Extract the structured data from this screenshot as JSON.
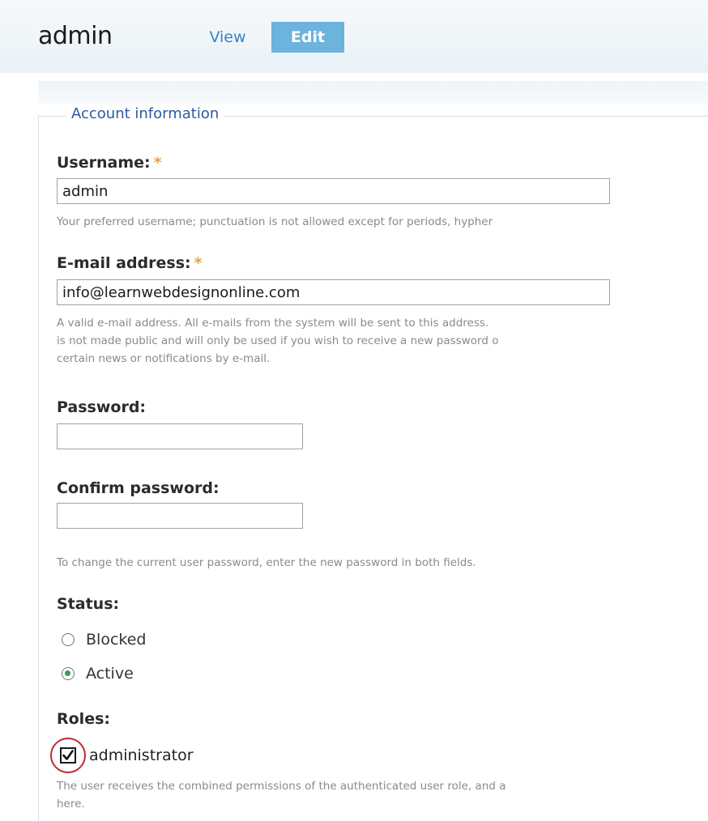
{
  "header": {
    "title": "admin",
    "tabs": [
      {
        "label": "View",
        "active": false
      },
      {
        "label": "Edit",
        "active": true
      }
    ]
  },
  "account": {
    "legend": "Account information",
    "username": {
      "label": "Username:",
      "required_mark": "*",
      "value": "admin",
      "description": "Your preferred username; punctuation is not allowed except for periods, hypher"
    },
    "email": {
      "label": "E-mail address:",
      "required_mark": "*",
      "value": "info@learnwebdesignonline.com",
      "description_lines": [
        "A valid e-mail address. All e-mails from the system will be sent to this address.",
        "is not made public and will only be used if you wish to receive a new password o",
        "certain news or notifications by e-mail."
      ]
    },
    "password": {
      "label": "Password:",
      "value": ""
    },
    "confirm_password": {
      "label": "Confirm password:",
      "value": "",
      "description": "To change the current user password, enter the new password in both fields."
    },
    "status": {
      "label": "Status:",
      "options": [
        {
          "label": "Blocked",
          "selected": false
        },
        {
          "label": "Active",
          "selected": true
        }
      ]
    },
    "roles": {
      "label": "Roles:",
      "items": [
        {
          "label": "administrator",
          "checked": true
        }
      ],
      "description_lines": [
        "The user receives the combined permissions of the authenticated user role, and a",
        "here."
      ]
    }
  },
  "colors": {
    "tab_active_bg": "#6cb3dd",
    "tab_link": "#3b82c4",
    "legend": "#2c5aa0",
    "required": "#f0a040",
    "highlight_circle": "#c0282b",
    "radio_selected": "#3a9a5a"
  }
}
